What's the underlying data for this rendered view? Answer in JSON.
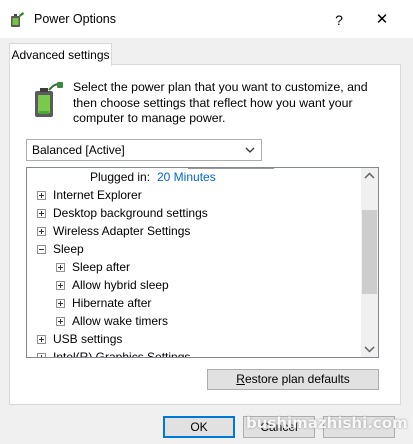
{
  "window": {
    "title": "Power Options",
    "help_label": "?",
    "close_label": "✕"
  },
  "tab": {
    "label": "Advanced settings"
  },
  "description": "Select the power plan that you want to customize, and then choose settings that reflect how you want your computer to manage power.",
  "plan_select": {
    "value": "Balanced [Active]"
  },
  "tree": {
    "plugged_in_label": "Plugged in:",
    "plugged_in_value": "20 Minutes",
    "items": [
      {
        "label": "Internet Explorer",
        "state": "collapsed",
        "level": 0
      },
      {
        "label": "Desktop background settings",
        "state": "collapsed",
        "level": 0
      },
      {
        "label": "Wireless Adapter Settings",
        "state": "collapsed",
        "level": 0
      },
      {
        "label": "Sleep",
        "state": "expanded",
        "level": 0
      },
      {
        "label": "Sleep after",
        "state": "collapsed",
        "level": 1
      },
      {
        "label": "Allow hybrid sleep",
        "state": "collapsed",
        "level": 1
      },
      {
        "label": "Hibernate after",
        "state": "collapsed",
        "level": 1
      },
      {
        "label": "Allow wake timers",
        "state": "collapsed",
        "level": 1
      },
      {
        "label": "USB settings",
        "state": "collapsed",
        "level": 0
      },
      {
        "label": "Intel(R) Graphics Settings",
        "state": "collapsed",
        "level": 0
      }
    ]
  },
  "buttons": {
    "restore_accel": "R",
    "restore_rest": "estore plan defaults",
    "ok": "OK",
    "cancel": "Cancel",
    "apply": ""
  },
  "watermark": "bushimazhishi.com",
  "colors": {
    "link_blue": "#0066cc",
    "focus_blue": "#0078d7"
  }
}
